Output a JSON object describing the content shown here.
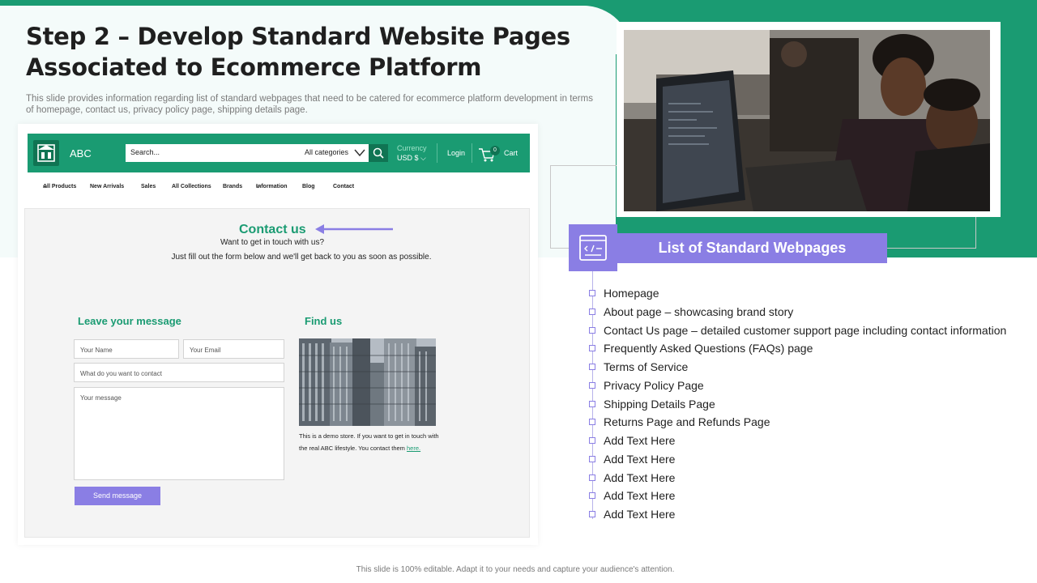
{
  "slide": {
    "title": "Step 2 – Develop Standard Website Pages Associated to Ecommerce Platform",
    "subtitle": "This slide provides information regarding list of standard webpages that need to be catered for ecommerce platform development in terms of homepage, contact us, privacy  policy page, shipping details page.",
    "footer": "This slide is 100% editable. Adapt it to your needs and capture your audience's attention."
  },
  "mockup": {
    "brand": "ABC",
    "search_placeholder": "Search...",
    "categories": "All categories",
    "currency_label": "Currency",
    "currency_value": "USD $",
    "login": "Login",
    "cart_count": "0",
    "cart": "Cart",
    "menu": [
      "All Products",
      "New Arrivals",
      "Sales",
      "All Collections",
      "Brands",
      "Information",
      "Blog",
      "Contact"
    ],
    "contact_title": "Contact us",
    "contact_sub1": "Want to get in touch with us?",
    "contact_sub2": "Just fill out the form below and we'll get back to you as soon as possible.",
    "leave_title": "Leave your message",
    "find_title": "Find us",
    "name_placeholder": "Your Name",
    "email_placeholder": "Your Email",
    "subject_placeholder": "What do you want to contact",
    "message_placeholder": "Your message",
    "send_button": "Send message",
    "demo_text": "This is a demo store. If you want to get in touch with the real ABC lifestyle. You contact them",
    "demo_link": "here."
  },
  "webpages": {
    "header": "List of Standard Webpages",
    "items": [
      "Homepage",
      "About page – showcasing brand story",
      "Contact Us page – detailed customer support page including contact information",
      "Frequently Asked Questions (FAQs) page",
      "Terms of Service",
      "Privacy Policy Page",
      "Shipping Details Page",
      "Returns Page and Refunds Page",
      "Add Text Here",
      "Add Text Here",
      "Add Text Here",
      "Add Text Here",
      "Add Text Here"
    ]
  },
  "colors": {
    "primary_green": "#1a9b72",
    "dark_green": "#107453",
    "purple": "#8a7ee4"
  },
  "icons": [
    "store-logo-icon",
    "search-icon",
    "chevron-down-icon",
    "cart-icon",
    "arrow-left-icon",
    "code-window-icon"
  ]
}
